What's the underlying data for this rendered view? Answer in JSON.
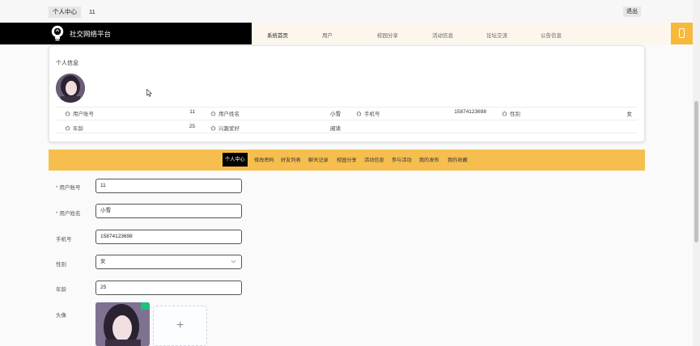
{
  "topbar": {
    "center_label": "个人中心",
    "user_id": "11",
    "logout_label": "退出"
  },
  "brand": {
    "name": "社交网络平台"
  },
  "nav": {
    "items": [
      {
        "label": "系统首页",
        "active": true
      },
      {
        "label": "用户"
      },
      {
        "label": "校园分享"
      },
      {
        "label": "活动信息"
      },
      {
        "label": "论坛交流"
      },
      {
        "label": "公告信息"
      }
    ]
  },
  "info": {
    "title": "个人信息",
    "fields": {
      "account": {
        "label": "用户账号",
        "value": "11"
      },
      "name": {
        "label": "用户姓名",
        "value": "小雪"
      },
      "phone": {
        "label": "手机号",
        "value": "15874123698"
      },
      "gender": {
        "label": "性别",
        "value": "女"
      },
      "age": {
        "label": "年龄",
        "value": "25"
      },
      "hobby": {
        "label": "兴趣爱好",
        "value": "阅读"
      }
    }
  },
  "subnav": {
    "tabs": [
      {
        "label": "个人中心",
        "active": true
      },
      {
        "label": "修改密码"
      },
      {
        "label": "好友列表"
      },
      {
        "label": "聊天记录"
      },
      {
        "label": "校园分享"
      },
      {
        "label": "活动信息"
      },
      {
        "label": "参与活动"
      },
      {
        "label": "我的发布"
      },
      {
        "label": "我的收藏"
      }
    ]
  },
  "form": {
    "account": {
      "label": "用户账号",
      "value": "11"
    },
    "name": {
      "label": "用户姓名",
      "value": "小雪"
    },
    "phone": {
      "label": "手机号",
      "value": "15874123698"
    },
    "gender": {
      "label": "性别",
      "value": "女"
    },
    "age": {
      "label": "年龄",
      "value": "25"
    },
    "avatar": {
      "label": "头像",
      "upload_symbol": "+"
    }
  },
  "icons": {
    "field_icon": "home-icon",
    "select_icon": "chevron-down-icon",
    "brand_icon": "lightbulb-icon",
    "nav_right_icon": "phone-icon"
  },
  "colors": {
    "accent": "#f6be4f",
    "nav_bg": "#fdf6ec",
    "brand_bg": "#000000",
    "required": "#e04040",
    "success": "#20c07c"
  }
}
